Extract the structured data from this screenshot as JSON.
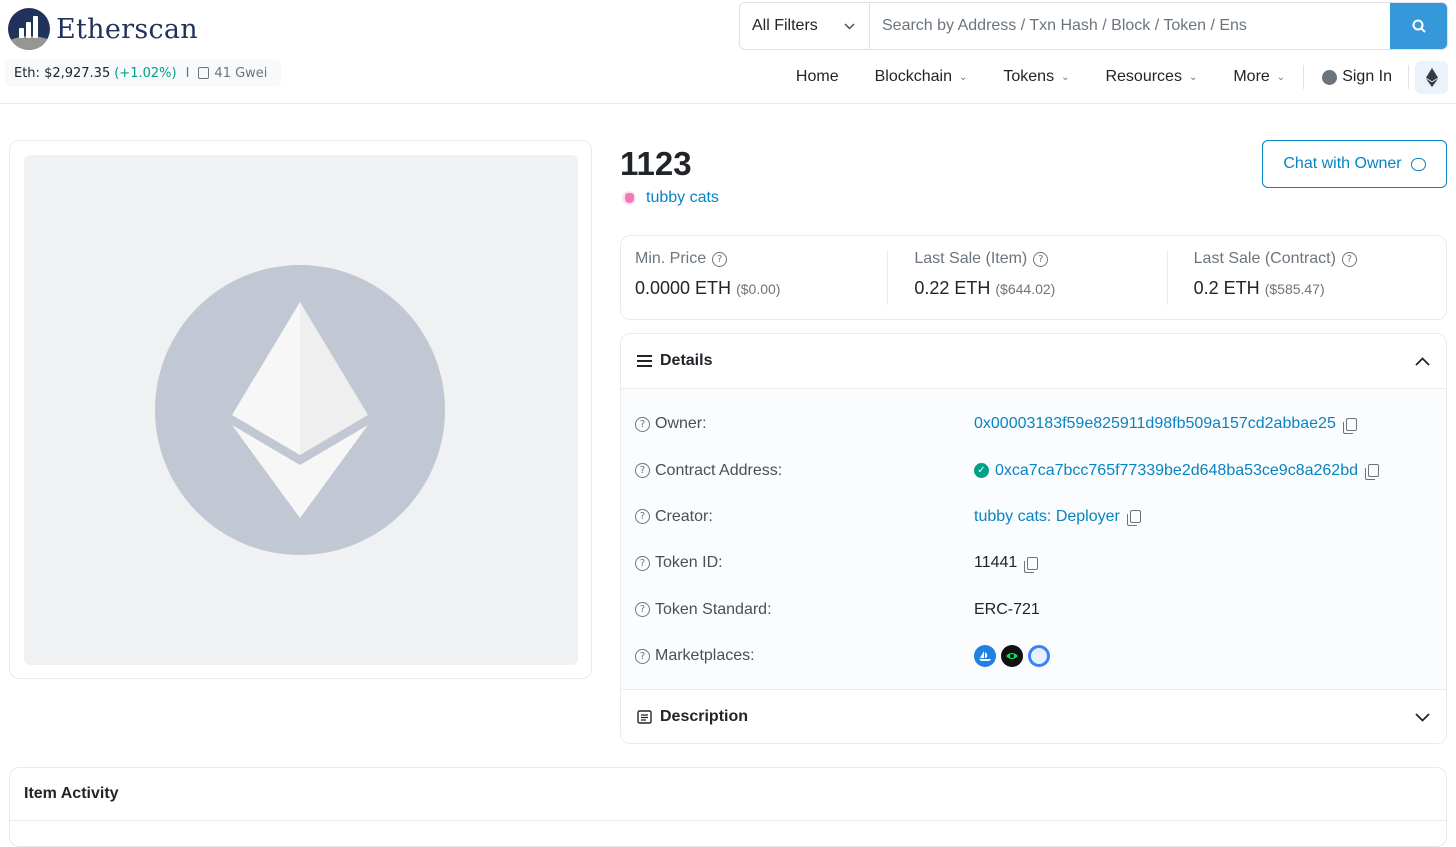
{
  "header": {
    "logo_text": "Etherscan",
    "eth_price_label": "Eth: $2,927.35",
    "eth_change": "(+1.02%)",
    "separator": "I",
    "gas": "41 Gwei",
    "search": {
      "filter_label": "All Filters",
      "placeholder": "Search by Address / Txn Hash / Block / Token / Ens"
    },
    "nav": {
      "home": "Home",
      "blockchain": "Blockchain",
      "tokens": "Tokens",
      "resources": "Resources",
      "more": "More",
      "sign_in": "Sign In"
    }
  },
  "token": {
    "title": "1123",
    "collection": "tubby cats",
    "chat_button": "Chat with Owner"
  },
  "prices": [
    {
      "label": "Min. Price",
      "value": "0.0000 ETH",
      "usd": "($0.00)"
    },
    {
      "label": "Last Sale (Item)",
      "value": "0.22 ETH",
      "usd": "($644.02)"
    },
    {
      "label": "Last Sale (Contract)",
      "value": "0.2 ETH",
      "usd": "($585.47)"
    }
  ],
  "details": {
    "title": "Details",
    "owner_label": "Owner:",
    "owner_value": "0x00003183f59e825911d98fb509a157cd2abbae25",
    "contract_label": "Contract Address:",
    "contract_value": "0xca7ca7bcc765f77339be2d648ba53ce9c8a262bd",
    "creator_label": "Creator:",
    "creator_value": "tubby cats: Deployer",
    "token_id_label": "Token ID:",
    "token_id_value": "11441",
    "standard_label": "Token Standard:",
    "standard_value": "ERC-721",
    "marketplaces_label": "Marketplaces:",
    "marketplaces": [
      "opensea-icon",
      "looksrare-icon",
      "rarible-icon"
    ]
  },
  "description": {
    "title": "Description"
  },
  "activity": {
    "title": "Item Activity"
  },
  "colors": {
    "link": "#0784c3",
    "accent": "#3498db",
    "positive": "#00a186",
    "brand": "#21325b"
  }
}
